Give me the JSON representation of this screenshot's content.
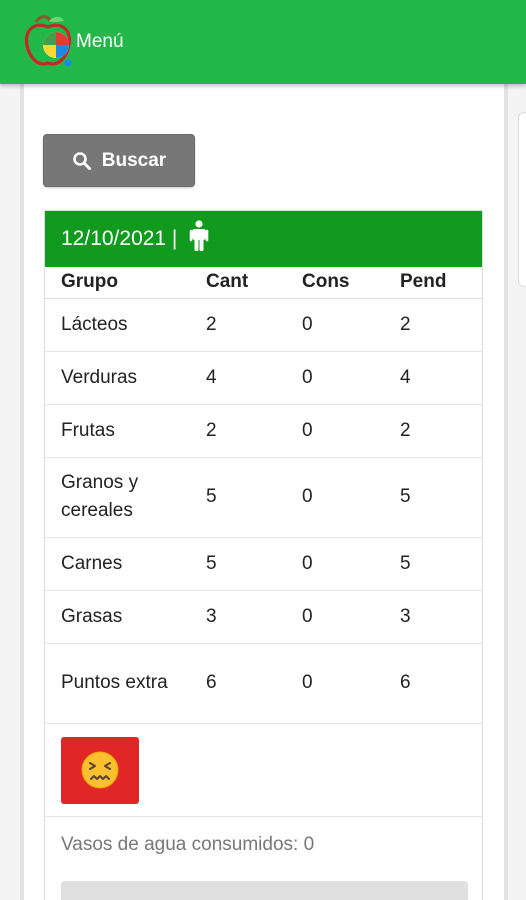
{
  "header": {
    "menu_label": "Menú",
    "bar_color": "#23b84a"
  },
  "search": {
    "label": "Buscar",
    "icon": "search-icon"
  },
  "summary": {
    "date_label": "12/10/2021 |",
    "person_icon": "person-icon",
    "header_color": "#129a1e",
    "columns": [
      "Grupo",
      "Cant",
      "Cons",
      "Pend"
    ],
    "rows": [
      {
        "group": "Lácteos",
        "cant": "2",
        "cons": "0",
        "pend": "2"
      },
      {
        "group": "Verduras",
        "cant": "4",
        "cons": "0",
        "pend": "4"
      },
      {
        "group": "Frutas",
        "cant": "2",
        "cons": "0",
        "pend": "2"
      },
      {
        "group": "Granos y cereales",
        "cant": "5",
        "cons": "0",
        "pend": "5"
      },
      {
        "group": "Carnes",
        "cant": "5",
        "cons": "0",
        "pend": "5"
      },
      {
        "group": "Grasas",
        "cant": "3",
        "cons": "0",
        "pend": "3"
      },
      {
        "group": "Puntos extra",
        "cant": "6",
        "cons": "0",
        "pend": "6"
      }
    ],
    "mood_icon": "confounded-face-icon",
    "mood_color": "#e02626",
    "water_text": "Vasos de agua consumidos: 0"
  }
}
